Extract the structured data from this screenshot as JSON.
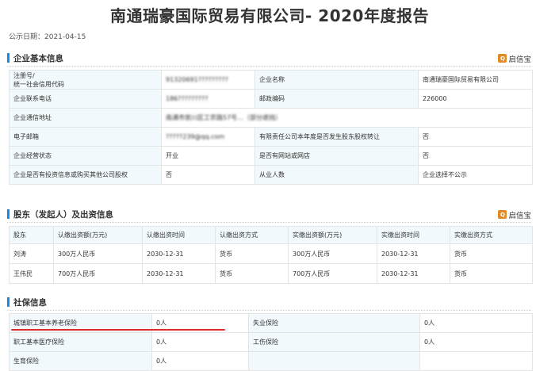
{
  "report": {
    "title": "南通瑞豪国际贸易有限公司- 2020年度报告",
    "publish_date": "公示日期：2021-04-15"
  },
  "brand": {
    "name": "启信宝",
    "color": "#e28b26"
  },
  "accent_color": "#128bed",
  "sections": {
    "basic": {
      "title": "企业基本信息",
      "rows": [
        [
          "注册号/\n统一社会信用代码",
          "91320691?????????",
          "企业名称",
          "南通瑞豪国际贸易有限公司"
        ],
        [
          "企业联系电话",
          "186?????????",
          "邮政编码",
          "226000"
        ],
        [
          "企业通信地址",
          "南通市崇川区工农路57号…（部分遮挡）",
          "",
          ""
        ],
        [
          "电子邮箱",
          "?????239@qq.com",
          "有限责任公司本年度是否发生股东股权转让",
          "否"
        ],
        [
          "企业经营状态",
          "开业",
          "是否有网站或网店",
          "否"
        ],
        [
          "企业是否有投资信息或购买其他公司股权",
          "否",
          "从业人数",
          "企业选择不公示"
        ]
      ]
    },
    "shareholders": {
      "title": "股东（发起人）及出资信息",
      "headers": [
        "股东",
        "认缴出资额(万元)",
        "认缴出资时间",
        "认缴出资方式",
        "实缴出资额(万元)",
        "实缴出资时间",
        "实缴出资方式"
      ],
      "rows": [
        [
          "刘涛",
          "300万人民币",
          "2030-12-31",
          "货币",
          "300万人民币",
          "2030-12-31",
          "货币"
        ],
        [
          "王伟民",
          "700万人民币",
          "2030-12-31",
          "货币",
          "700万人民币",
          "2030-12-31",
          "货币"
        ]
      ]
    },
    "social": {
      "title": "社保信息",
      "rows": [
        [
          "城镇职工基本养老保险",
          "0人",
          "失业保险",
          "0人"
        ],
        [
          "职工基本医疗保险",
          "0人",
          "工伤保险",
          "0人"
        ],
        [
          "生育保险",
          "0人",
          "",
          ""
        ]
      ]
    }
  }
}
